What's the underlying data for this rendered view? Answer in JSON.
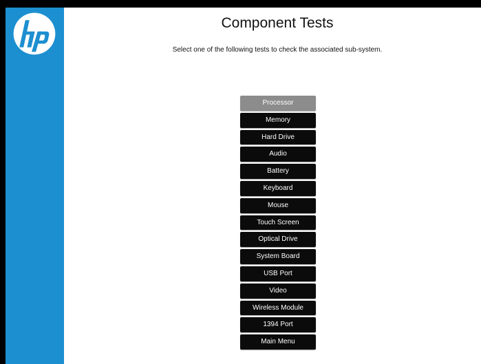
{
  "brand": {
    "logo_text": "hp",
    "sidebar_color": "#1c8fd0"
  },
  "page": {
    "title": "Component Tests",
    "subtitle": "Select one of the following tests to check the associated sub-system."
  },
  "menu": {
    "selected_index": 0,
    "items": [
      {
        "label": "Processor"
      },
      {
        "label": "Memory"
      },
      {
        "label": "Hard Drive"
      },
      {
        "label": "Audio"
      },
      {
        "label": "Battery"
      },
      {
        "label": "Keyboard"
      },
      {
        "label": "Mouse"
      },
      {
        "label": "Touch Screen"
      },
      {
        "label": "Optical Drive"
      },
      {
        "label": "System Board"
      },
      {
        "label": "USB Port"
      },
      {
        "label": "Video"
      },
      {
        "label": "Wireless Module"
      },
      {
        "label": "1394 Port"
      },
      {
        "label": "Main Menu"
      }
    ]
  }
}
